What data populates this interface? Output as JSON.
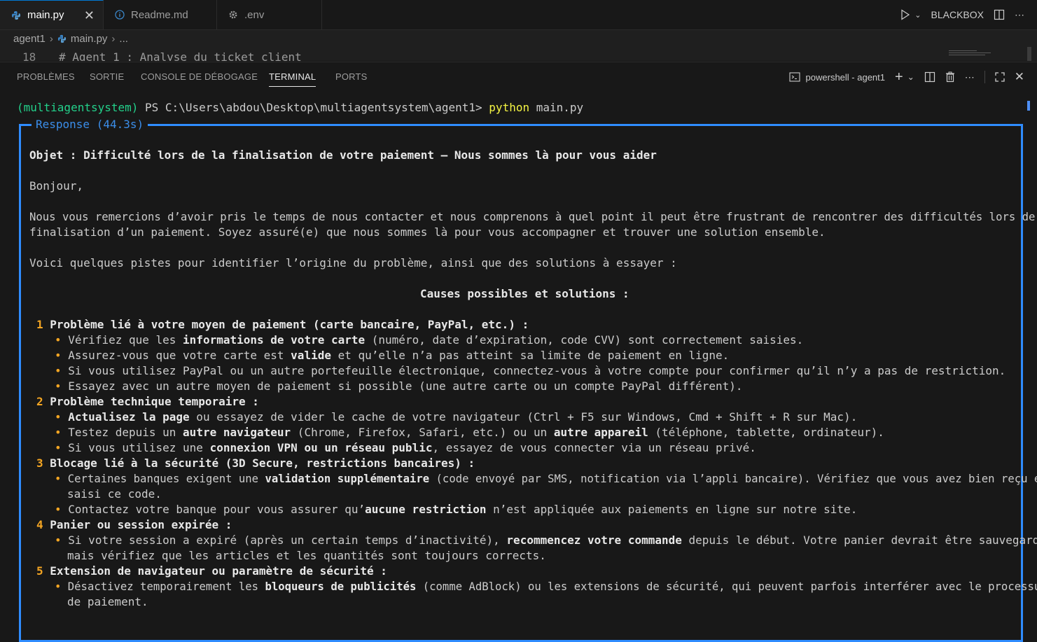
{
  "tabs": [
    {
      "label": "main.py",
      "icon": "python-icon",
      "active": true
    },
    {
      "label": "Readme.md",
      "icon": "info-icon",
      "active": false
    },
    {
      "label": ".env",
      "icon": "gear-icon",
      "active": false
    }
  ],
  "titlebar_right": {
    "extension_label": "BLACKBOX"
  },
  "breadcrumb": {
    "folder": "agent1",
    "file": "main.py",
    "more": "..."
  },
  "code_peek": {
    "line_number": "18",
    "text": "# Agent 1 : Analyse du ticket client"
  },
  "panel_tabs": [
    "PROBLÈMES",
    "SORTIE",
    "CONSOLE DE DÉBOGAGE",
    "TERMINAL",
    "PORTS"
  ],
  "panel_active_tab": "TERMINAL",
  "terminal_instance": "powershell - agent1",
  "terminal": {
    "env": "(multiagentsystem)",
    "path": " PS C:\\Users\\abdou\\Desktop\\multiagentsystem\\agent1> ",
    "cmd_word": "python",
    "cmd_rest": " main.py",
    "response_title": "Response (44.3s)",
    "subject": "Objet : Difficulté lors de la finalisation de votre paiement – Nous sommes là pour vous aider",
    "greeting": "Bonjour,",
    "intro1": "Nous vous remercions d’avoir pris le temps de nous contacter et nous comprenons à quel point il peut être frustrant de rencontrer des difficultés lors de la",
    "intro2": "finalisation d’un paiement. Soyez assuré(e) que nous sommes là pour vous accompagner et trouver une solution ensemble.",
    "lead": "Voici quelques pistes pour identifier l’origine du problème, ainsi que des solutions à essayer :",
    "heading": "Causes possibles et solutions :",
    "s1": {
      "num": "1",
      "title": "Problème lié à votre moyen de paiement (carte bancaire, PayPal, etc.) :",
      "b1a": "Vérifiez que les ",
      "b1b": "informations de votre carte",
      "b1c": " (numéro, date d’expiration, code CVV) sont correctement saisies.",
      "b2a": "Assurez-vous que votre carte est ",
      "b2b": "valide",
      "b2c": " et qu’elle n’a pas atteint sa limite de paiement en ligne.",
      "b3": "Si vous utilisez PayPal ou un autre portefeuille électronique, connectez-vous à votre compte pour confirmer qu’il n’y a pas de restriction.",
      "b4": "Essayez avec un autre moyen de paiement si possible (une autre carte ou un compte PayPal différent)."
    },
    "s2": {
      "num": "2",
      "title": "Problème technique temporaire :",
      "b1a": "Actualisez la page",
      "b1b": " ou essayez de vider le cache de votre navigateur (Ctrl + F5 sur Windows, Cmd + Shift + R sur Mac).",
      "b2a": "Testez depuis un ",
      "b2b": "autre navigateur",
      "b2c": " (Chrome, Firefox, Safari, etc.) ou un ",
      "b2d": "autre appareil",
      "b2e": " (téléphone, tablette, ordinateur).",
      "b3a": "Si vous utilisez une ",
      "b3b": "connexion VPN ou un réseau public",
      "b3c": ", essayez de vous connecter via un réseau privé."
    },
    "s3": {
      "num": "3",
      "title": "Blocage lié à la sécurité (3D Secure, restrictions bancaires) :",
      "b1a": "Certaines banques exigent une ",
      "b1b": "validation supplémentaire",
      "b1c": " (code envoyé par SMS, notification via l’appli bancaire). Vérifiez que vous avez bien reçu et",
      "b1d": "saisi ce code.",
      "b2a": "Contactez votre banque pour vous assurer qu’",
      "b2b": "aucune restriction",
      "b2c": " n’est appliquée aux paiements en ligne sur notre site."
    },
    "s4": {
      "num": "4",
      "title": "Panier ou session expirée :",
      "b1a": "Si votre session a expiré (après un certain temps d’inactivité), ",
      "b1b": "recommencez votre commande",
      "b1c": " depuis le début. Votre panier devrait être sauvegardé,",
      "b1d": "mais vérifiez que les articles et les quantités sont toujours corrects."
    },
    "s5": {
      "num": "5",
      "title": "Extension de navigateur ou paramètre de sécurité :",
      "b1a": "Désactivez temporairement les ",
      "b1b": "bloqueurs de publicités",
      "b1c": " (comme AdBlock) ou les extensions de sécurité, qui peuvent parfois interférer avec le processus",
      "b1d": "de paiement."
    },
    "bullet": "•"
  },
  "colors": {
    "accent": "#0078d4",
    "env_green": "#23d18b",
    "cmd_yellow": "#f5f543",
    "box_blue": "#2f8cff",
    "number_orange": "#f5a623"
  }
}
